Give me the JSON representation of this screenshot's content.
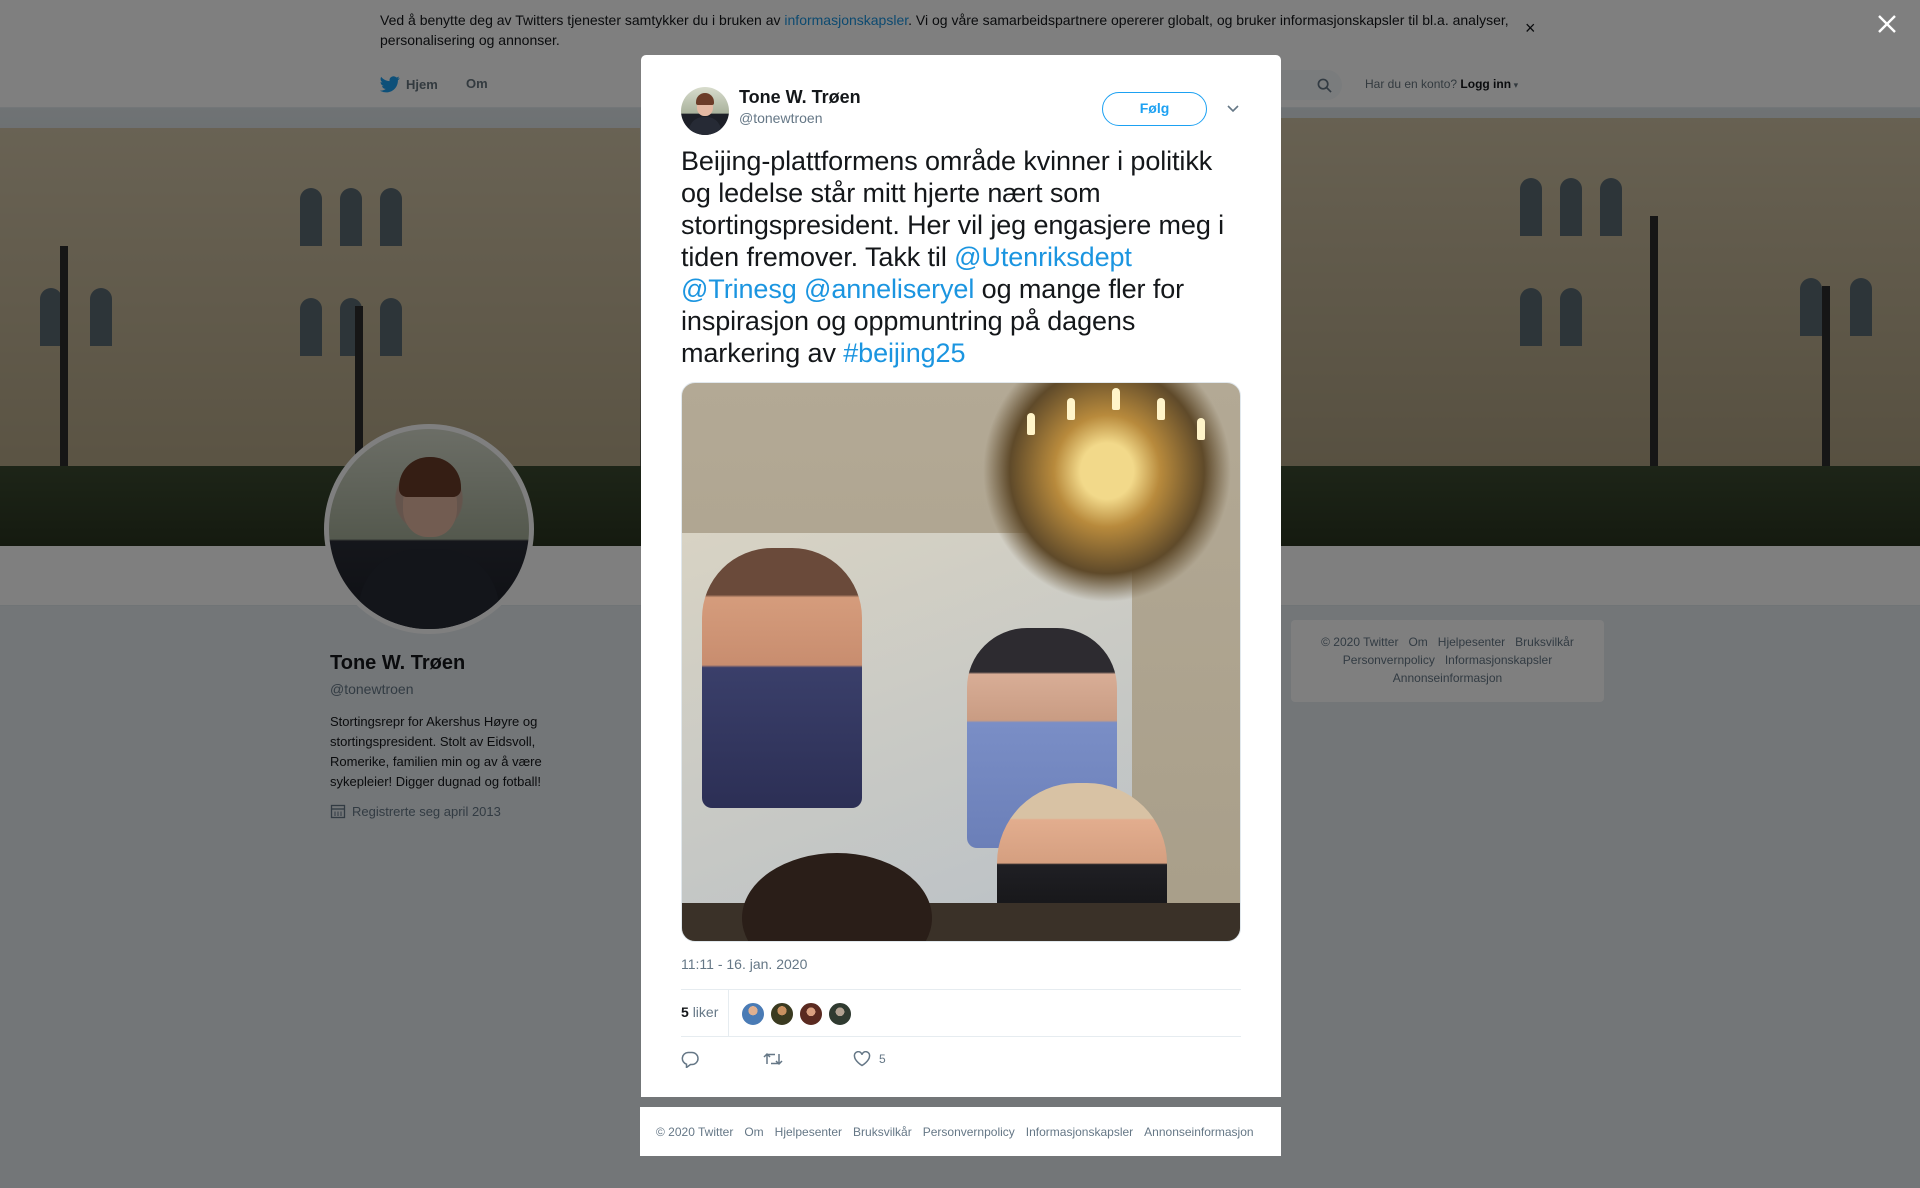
{
  "cookie": {
    "text_before": "Ved å benytte deg av Twitters tjenester samtykker du i bruken av ",
    "link": "informasjonskapsler",
    "text_after": ". Vi og våre samarbeidspartnere opererer globalt, og bruker informasjonskapsler til bl.a. analyser, personalisering og annonser.",
    "close": "×"
  },
  "nav": {
    "home": "Hjem",
    "about": "Om",
    "login_prompt": "Har du en konto?",
    "login": "Logg inn"
  },
  "profile": {
    "name": "Tone W. Trøen",
    "handle": "@tonewtroen",
    "bio": "Stortingsrepr for Akershus Høyre og stortingspresident. Stolt av Eidsvoll, Romerike, familien min og av å være sykepleier! Digger dugnad og fotball!",
    "joined": "Registrerte seg april 2013"
  },
  "side_footer": {
    "links": [
      "© 2020 Twitter",
      "Om",
      "Hjelpesenter",
      "Bruksvilkår",
      "Personvernpolicy",
      "Informasjonskapsler",
      "Annonseinformasjon"
    ]
  },
  "modal": {
    "close": "✕",
    "author_name": "Tone W. Trøen",
    "author_handle": "@tonewtroen",
    "follow": "Følg",
    "text_1": "Beijing-plattformens område kvinner i politikk og ledelse står mitt hjerte nært som stortingspresident. Her vil jeg engasjere meg i tiden fremover. Takk til ",
    "mention_1": "@Utenriksdept",
    "mention_2": "@Trinesg",
    "mention_3": "@anneliseryel",
    "text_2": " og mange fler for inspirasjon og oppmuntring på dagens markering av ",
    "hashtag": "#beijing25",
    "timestamp": "11:11 - 16. jan. 2020",
    "likes_count": "5",
    "likes_label": "liker",
    "heart_count": "5"
  },
  "modal_footer": {
    "links": [
      "© 2020 Twitter",
      "Om",
      "Hjelpesenter",
      "Bruksvilkår",
      "Personvernpolicy",
      "Informasjonskapsler",
      "Annonseinformasjon"
    ]
  },
  "colors": {
    "link": "#1b95e0",
    "twitter_blue": "#1da1f2",
    "muted": "#657786"
  },
  "icons": [
    "twitter-bird-icon",
    "search-icon",
    "calendar-icon",
    "chevron-down-icon",
    "reply-icon",
    "retweet-icon",
    "heart-icon",
    "close-icon"
  ]
}
